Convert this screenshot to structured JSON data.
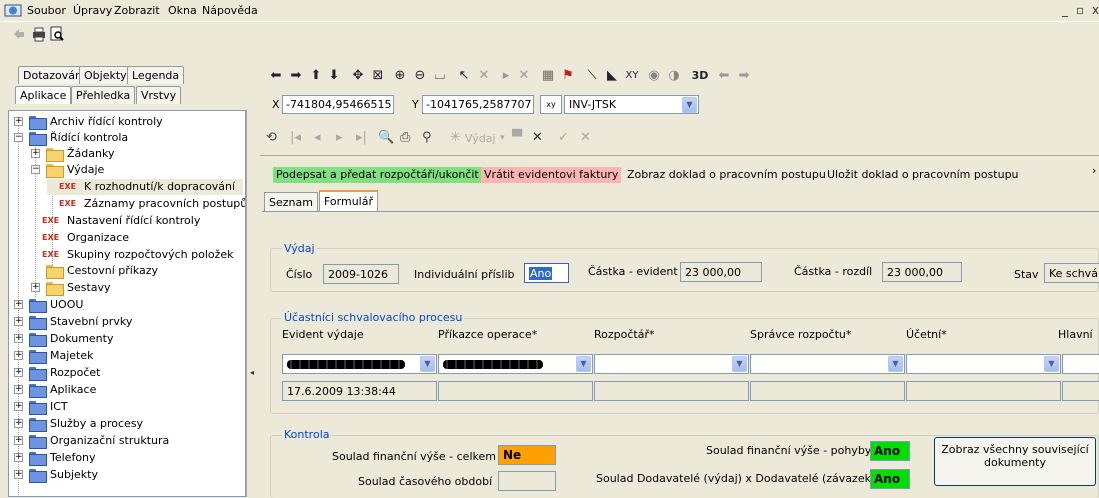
{
  "menu": [
    "Soubor",
    "Úpravy",
    "Zobrazit",
    "Okna",
    "Nápověda"
  ],
  "window_controls": {
    "minimize": "_",
    "restore": "▫",
    "close": "x"
  },
  "left_tabs_row1": [
    "Dotazování",
    "Objekty",
    "Legenda"
  ],
  "left_tabs_row2": [
    "Aplikace",
    "Přehledka",
    "Vrstvy"
  ],
  "tree": [
    {
      "label": "Archiv řídící kontroly"
    },
    {
      "label": "Řídící kontrola"
    },
    {
      "label": "Žádanky"
    },
    {
      "label": "Výdaje"
    },
    {
      "label": "K rozhodnutí/k dopracování",
      "badge": "EXE"
    },
    {
      "label": "Záznamy pracovních postupů",
      "badge": "EXE"
    },
    {
      "label": "Nastavení řídící kontroly",
      "badge": "EXE"
    },
    {
      "label": "Organizace",
      "badge": "EXE"
    },
    {
      "label": "Skupiny rozpočtových položek",
      "badge": "EXE"
    },
    {
      "label": "Cestovní příkazy"
    },
    {
      "label": "Sestavy"
    },
    {
      "label": "UOOU"
    },
    {
      "label": "Stavební prvky"
    },
    {
      "label": "Dokumenty"
    },
    {
      "label": "Majetek"
    },
    {
      "label": "Rozpočet"
    },
    {
      "label": "Aplikace"
    },
    {
      "label": "ICT"
    },
    {
      "label": "Služby a procesy"
    },
    {
      "label": "Organizační struktura"
    },
    {
      "label": "Telefony"
    },
    {
      "label": "Subjekty"
    }
  ],
  "coords": {
    "x_label": "X",
    "x_value": "-741804,95466515",
    "y_label": "Y",
    "y_value": "-1041765,2587707",
    "crs_button": "xy",
    "crs": "INV-JTSK",
    "toolbar_xy": "XY",
    "toolbar_3d": "3D"
  },
  "nav": {
    "vydaj_label": "Výdaj"
  },
  "actions": [
    "Podepsat a předat rozpočtáři/ukončit",
    "Vrátit evidentovi faktury",
    "Zobraz doklad o pracovním postupu",
    "Uložit doklad o pracovním postupu"
  ],
  "form_tabs": [
    "Seznam",
    "Formulář"
  ],
  "vydaj": {
    "title": "Výdaj",
    "cislo_label": "Číslo",
    "cislo": "2009-1026",
    "prislib_label": "Individuální příslib",
    "prislib": "Ano",
    "castka_evident_label": "Částka - evident",
    "castka_evident": "23 000,00",
    "castka_rozdil_label": "Částka - rozdíl",
    "castka_rozdil": "23 000,00",
    "stav_label": "Stav",
    "stav": "Ke schvá"
  },
  "ucastnici": {
    "title": "Účastníci schvalovacího procesu",
    "columns": [
      "Evident výdaje",
      "Příkazce operace*",
      "Rozpočtář*",
      "Správce rozpočtu*",
      "Účetní*",
      "Hlavní"
    ],
    "date": "17.6.2009 13:38:44"
  },
  "kontrola": {
    "title": "Kontrola",
    "celkem_label": "Soulad finanční výše - celkem",
    "celkem": "Ne",
    "obdobi_label": "Soulad časového období",
    "obdobi": "",
    "pohyby_label": "Soulad finanční výše - pohyby",
    "pohyby": "Ano",
    "dodavatele_label": "Soulad Dodavatelé (výdaj) x Dodavatelé (závazek)",
    "dodavatele": "Ano",
    "button_line1": "Zobraz všechny související",
    "button_line2": "dokumenty"
  },
  "colors": {
    "ok": "#00e000",
    "warn": "#ffa000",
    "action_ok": "#7fe07f",
    "action_return": "#ffb4b4",
    "group_title": "#0046d5"
  }
}
